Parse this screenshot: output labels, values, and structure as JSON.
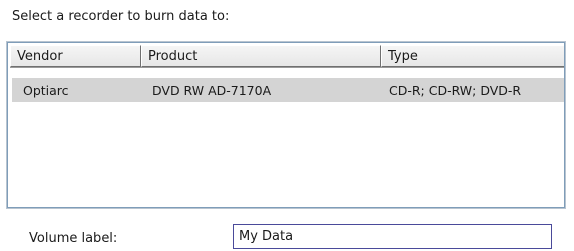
{
  "prompt_text": "Select a recorder to burn data to:",
  "recorder_list": {
    "columns": [
      "Vendor",
      "Product",
      "Type"
    ],
    "rows": [
      {
        "vendor": "Optiarc",
        "product": "DVD RW AD-7170A",
        "type": "CD-R; CD-RW; DVD-R",
        "selected": true
      }
    ]
  },
  "volume": {
    "label": "Volume label:",
    "value": "My Data"
  },
  "colors": {
    "selected_row": "#d4d4d4",
    "list_border": "#7f9db9",
    "input_border": "#4a4a9a"
  }
}
